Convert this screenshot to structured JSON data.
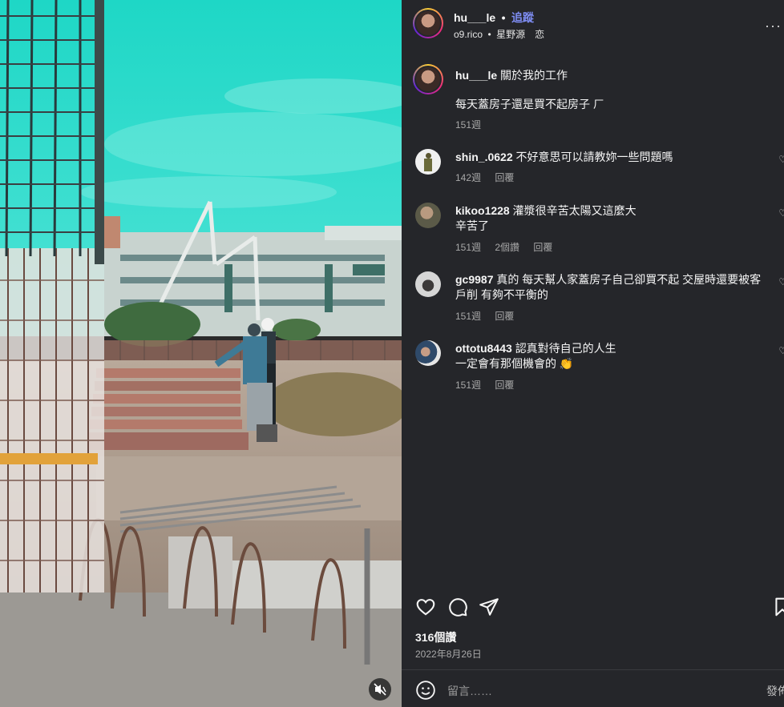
{
  "post": {
    "username": "hu___le",
    "separator": "•",
    "follow_label": "追蹤",
    "location": "o9.rico",
    "music_sep": "•",
    "music": "星野源　恋",
    "more_icon": "more-horizontal-icon"
  },
  "caption": {
    "username": "hu___le",
    "text_line1": "關於我的工作",
    "text_line2": "每天蓋房子還是買不起房子 ㄏ",
    "time": "151週"
  },
  "comments": [
    {
      "username": "shin_.0622",
      "text_lines": [
        "不好意思可以請教妳一些問題嗎"
      ],
      "time": "142週",
      "replies": "",
      "reply_label": "回覆"
    },
    {
      "username": "kikoo1228",
      "text_lines": [
        "灌漿很辛苦太陽又這麼大",
        "辛苦了"
      ],
      "time": "151週",
      "replies": "2個讚",
      "reply_label": "回覆"
    },
    {
      "username": "gc9987",
      "text_lines": [
        "真的 每天幫人家蓋房子自己卻買不起 交屋時還要被客",
        "戶削 有夠不平衡的"
      ],
      "time": "151週",
      "replies": "",
      "reply_label": "回覆"
    },
    {
      "username": "ottotu8443",
      "text_lines": [
        "認真對待自己的人生",
        "一定會有那個機會的 👏"
      ],
      "time": "151週",
      "replies": "",
      "reply_label": "回覆"
    }
  ],
  "actions": {
    "like_icon": "heart-icon",
    "comment_icon": "comment-icon",
    "share_icon": "send-icon",
    "save_icon": "bookmark-icon"
  },
  "likes_text": "316個讚",
  "date_text": "2022年8月26日",
  "comment_box": {
    "emoji_icon": "emoji-icon",
    "placeholder": "留言……",
    "post_label": "發佈"
  },
  "media": {
    "mute_icon": "muted-speaker-icon"
  },
  "colors": {
    "panel_bg": "#25262a",
    "follow": "#7f8ef5",
    "meta": "#a8a8a8",
    "sky": "#2ed9c9"
  }
}
